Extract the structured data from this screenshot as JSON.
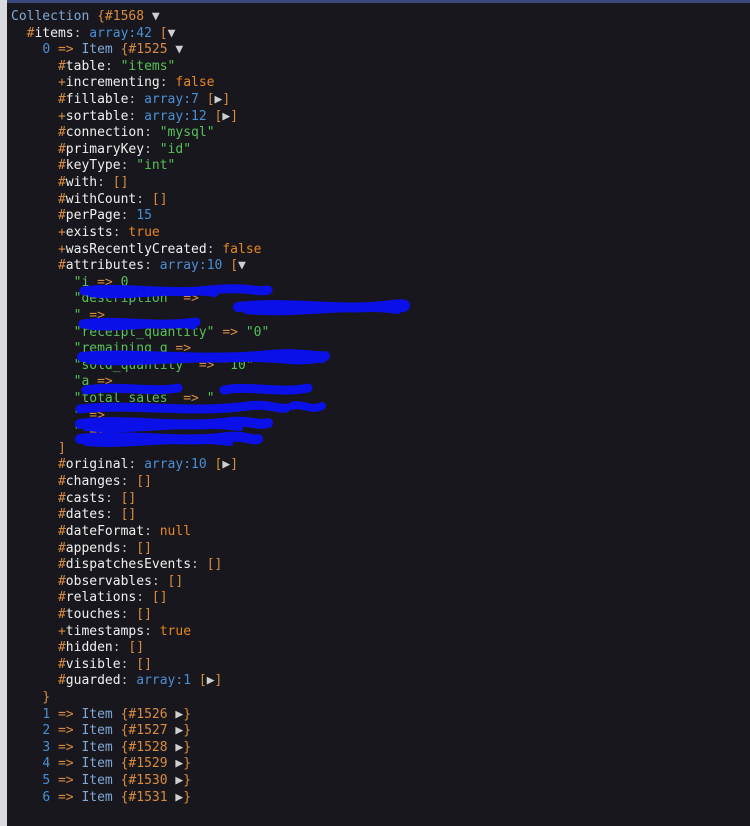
{
  "window": {
    "kind": "var-dumper-output",
    "background_color": "#18171d",
    "page_background_color": "#1c1b22",
    "top_border_color": "#3b4a7a",
    "left_strip_color": "#d8dae0",
    "redaction_color": "#0b10f0"
  },
  "colors": {
    "class_name": "#7fa8d6",
    "sigil": "#d98c3f",
    "property": "#f0f0f0",
    "string": "#56c05a",
    "boolean": "#e8861f",
    "number": "#4a8fd4",
    "array": "#4a8fd4",
    "brace": "#d98c3f",
    "arrow": "#d98c3f",
    "caret": "#cfcfcf"
  },
  "glyphs": {
    "caret_down": "▼",
    "caret_right": "▶",
    "arrow": "=>",
    "sigil_protected": "#",
    "sigil_public": "+",
    "hash": "#"
  },
  "dump": {
    "root": {
      "class": "Collection",
      "object_id": "#1568",
      "brace_open": "{",
      "toggle": "▼"
    },
    "items_node": {
      "sigil": "#",
      "name": "items",
      "colon": ":",
      "type": "array:42",
      "bracket_open": "[",
      "toggle": "▼"
    },
    "first_item": {
      "index": "0",
      "arrow": "=>",
      "class": "Item",
      "object_id": "#1525",
      "brace_open": "{",
      "toggle": "▼"
    },
    "properties": [
      {
        "sigil": "#",
        "name": "table",
        "value": "\"items\"",
        "value_kind": "string"
      },
      {
        "sigil": "+",
        "name": "incrementing",
        "value": "false",
        "value_kind": "boolean"
      },
      {
        "sigil": "#",
        "name": "fillable",
        "value": "array:7",
        "value_kind": "array",
        "collapsed": true
      },
      {
        "sigil": "+",
        "name": "sortable",
        "value": "array:12",
        "value_kind": "array",
        "collapsed": true
      },
      {
        "sigil": "#",
        "name": "connection",
        "value": "\"mysql\"",
        "value_kind": "string"
      },
      {
        "sigil": "#",
        "name": "primaryKey",
        "value": "\"id\"",
        "value_kind": "string"
      },
      {
        "sigil": "#",
        "name": "keyType",
        "value": "\"int\"",
        "value_kind": "string"
      },
      {
        "sigil": "#",
        "name": "with",
        "value": "[]",
        "value_kind": "empty-array"
      },
      {
        "sigil": "#",
        "name": "withCount",
        "value": "[]",
        "value_kind": "empty-array"
      },
      {
        "sigil": "#",
        "name": "perPage",
        "value": "15",
        "value_kind": "number"
      },
      {
        "sigil": "+",
        "name": "exists",
        "value": "true",
        "value_kind": "boolean"
      },
      {
        "sigil": "+",
        "name": "wasRecentlyCreated",
        "value": "false",
        "value_kind": "boolean"
      }
    ],
    "attributes_node": {
      "sigil": "#",
      "name": "attributes",
      "colon": ":",
      "type": "array:10",
      "bracket_open": "[",
      "toggle": "▼"
    },
    "attributes": [
      {
        "key": "\"i",
        "arrow": "=>",
        "value": "0",
        "redacted": true,
        "note": "key and value obscured by blue marker"
      },
      {
        "key": "\"description\"",
        "arrow": "=>",
        "value": "\"",
        "redacted": true,
        "note": "value obscured by blue marker"
      },
      {
        "key": "\"",
        "arrow": "=>",
        "value": "",
        "redacted": true,
        "note": "entire line obscured by blue marker"
      },
      {
        "key": "\"receipt_quantity\"",
        "arrow": "=>",
        "value": "\"0\"",
        "redacted": false
      },
      {
        "key": "\"remaining_q",
        "arrow": "=>",
        "value": "",
        "redacted": true,
        "note": "entire line obscured by blue marker"
      },
      {
        "key": "\"sold_quantity\"",
        "arrow": "=>",
        "value": "\"10\"",
        "redacted": false
      },
      {
        "key": "\"a",
        "arrow": "=>",
        "value": "",
        "redacted": true,
        "note": "average_price, obscured by blue marker"
      },
      {
        "key": "\"total_sales_",
        "arrow": "=>",
        "value": "\"",
        "redacted": true,
        "note": "obscured by blue marker"
      },
      {
        "key": "\"",
        "arrow": "=>",
        "value": "",
        "redacted": true,
        "note": "entire line obscured by blue marker"
      },
      {
        "key": "\"",
        "arrow": "=>",
        "value": "",
        "redacted": true,
        "note": "entire line obscured by blue marker"
      }
    ],
    "attributes_close": "]",
    "properties_after": [
      {
        "sigil": "#",
        "name": "original",
        "value": "array:10",
        "value_kind": "array",
        "collapsed": true
      },
      {
        "sigil": "#",
        "name": "changes",
        "value": "[]",
        "value_kind": "empty-array"
      },
      {
        "sigil": "#",
        "name": "casts",
        "value": "[]",
        "value_kind": "empty-array"
      },
      {
        "sigil": "#",
        "name": "dates",
        "value": "[]",
        "value_kind": "empty-array"
      },
      {
        "sigil": "#",
        "name": "dateFormat",
        "value": "null",
        "value_kind": "boolean"
      },
      {
        "sigil": "#",
        "name": "appends",
        "value": "[]",
        "value_kind": "empty-array"
      },
      {
        "sigil": "#",
        "name": "dispatchesEvents",
        "value": "[]",
        "value_kind": "empty-array"
      },
      {
        "sigil": "#",
        "name": "observables",
        "value": "[]",
        "value_kind": "empty-array"
      },
      {
        "sigil": "#",
        "name": "relations",
        "value": "[]",
        "value_kind": "empty-array"
      },
      {
        "sigil": "#",
        "name": "touches",
        "value": "[]",
        "value_kind": "empty-array"
      },
      {
        "sigil": "+",
        "name": "timestamps",
        "value": "true",
        "value_kind": "boolean"
      },
      {
        "sigil": "#",
        "name": "hidden",
        "value": "[]",
        "value_kind": "empty-array"
      },
      {
        "sigil": "#",
        "name": "visible",
        "value": "[]",
        "value_kind": "empty-array"
      },
      {
        "sigil": "#",
        "name": "guarded",
        "value": "array:1",
        "value_kind": "array",
        "collapsed": true
      }
    ],
    "first_item_close": "}",
    "sibling_items": [
      {
        "index": "1",
        "arrow": "=>",
        "class": "Item",
        "object_id": "#1526",
        "toggle": "▶"
      },
      {
        "index": "2",
        "arrow": "=>",
        "class": "Item",
        "object_id": "#1527",
        "toggle": "▶"
      },
      {
        "index": "3",
        "arrow": "=>",
        "class": "Item",
        "object_id": "#1528",
        "toggle": "▶"
      },
      {
        "index": "4",
        "arrow": "=>",
        "class": "Item",
        "object_id": "#1529",
        "toggle": "▶"
      },
      {
        "index": "5",
        "arrow": "=>",
        "class": "Item",
        "object_id": "#1530",
        "toggle": "▶"
      },
      {
        "index": "6",
        "arrow": "=>",
        "class": "Item",
        "object_id": "#1531",
        "toggle": "▶"
      }
    ]
  }
}
